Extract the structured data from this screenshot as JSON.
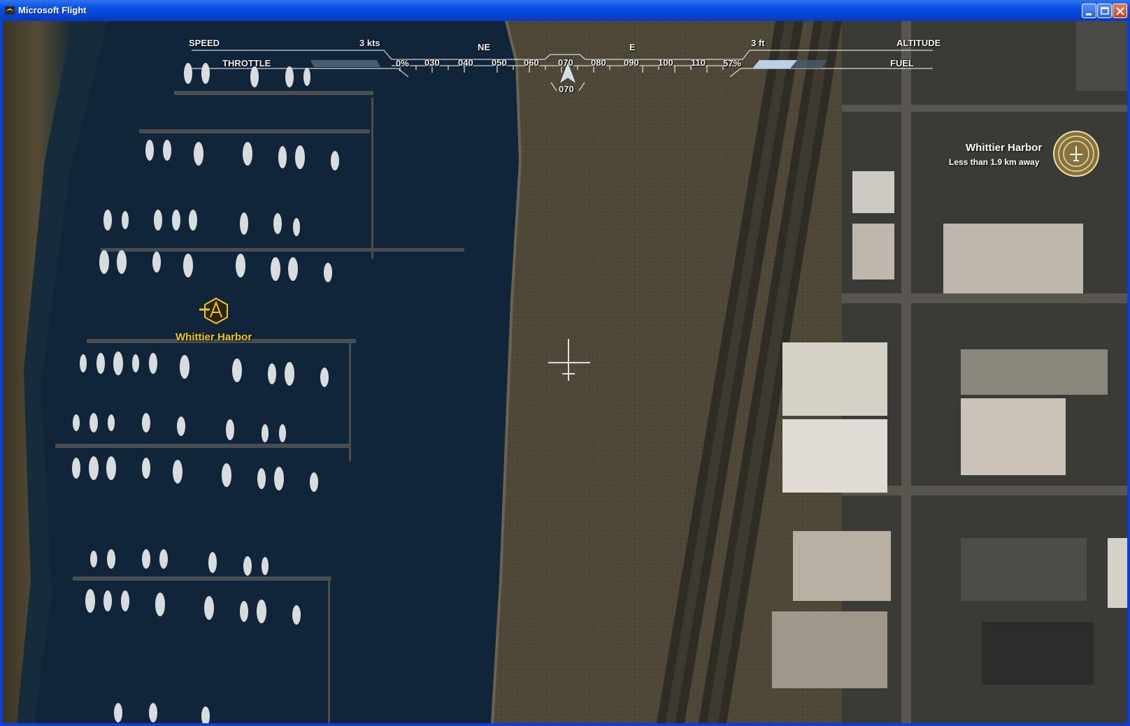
{
  "window": {
    "title": "Microsoft Flight",
    "controls": [
      "minimize",
      "maximize",
      "close"
    ]
  },
  "hud": {
    "speed_label": "SPEED",
    "speed_value": "3 kts",
    "throttle_label": "THROTTLE",
    "throttle_value": "0%",
    "throttle_level": 0,
    "altitude_label": "ALTITUDE",
    "altitude_value": "3 ft",
    "fuel_label": "FUEL",
    "fuel_value": "57%",
    "fuel_level": 0.57,
    "compass": {
      "cardinals": [
        "NE",
        "E"
      ],
      "ticks": [
        "030",
        "040",
        "050",
        "060",
        "070",
        "080",
        "090",
        "100",
        "110"
      ],
      "heading": "070"
    }
  },
  "map": {
    "harbor_marker_label": "Whittier Harbor",
    "destination_title": "Whittier Harbor",
    "destination_distance": "Less than 1.9 km away"
  },
  "colors": {
    "marker_yellow": "#f5c518",
    "hud_white": "#f2f2f2",
    "water": "#10243a",
    "field": "#4e4737"
  },
  "icons": [
    "app-icon",
    "minimize-icon",
    "maximize-icon",
    "close-icon",
    "heading-arrow-icon",
    "crosshair-icon",
    "airport-marker-icon",
    "destination-ring-icon"
  ]
}
